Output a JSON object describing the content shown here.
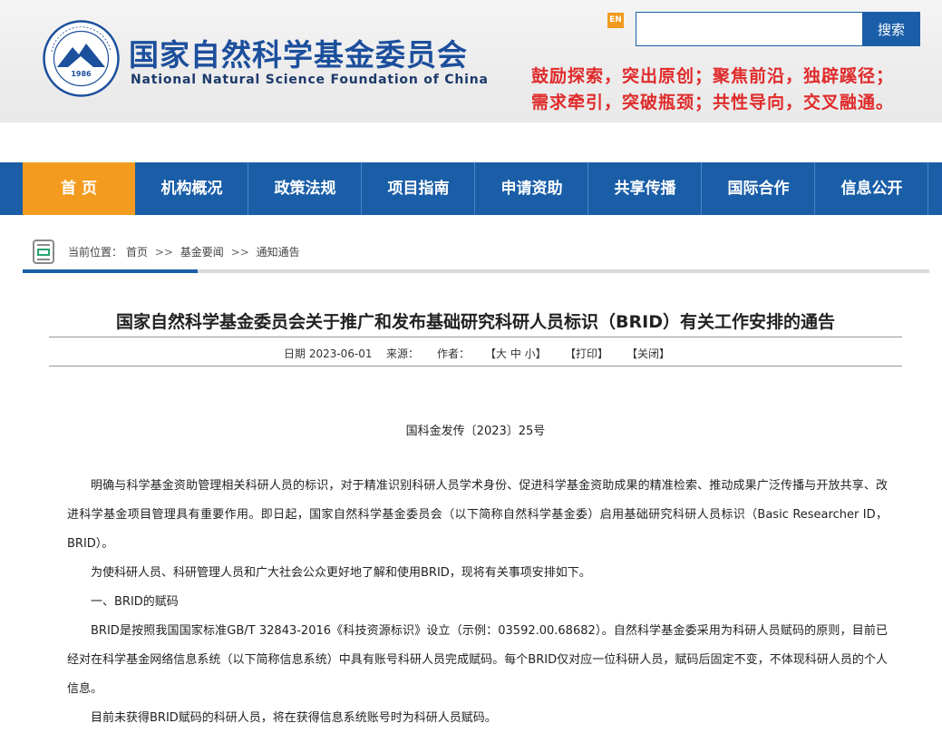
{
  "header": {
    "title_cn": "国家自然科学基金委员会",
    "title_en": "National Natural Science Foundation of China",
    "logo_year": "1986",
    "en_label": "EN",
    "search_placeholder": "",
    "search_label": "搜索",
    "slogan_line1": "鼓励探索，突出原创；聚焦前沿，独辟蹊径；",
    "slogan_line2": "需求牵引，突破瓶颈；共性导向，交叉融通。"
  },
  "nav": {
    "items": [
      "首  页",
      "机构概况",
      "政策法规",
      "项目指南",
      "申请资助",
      "共享传播",
      "国际合作",
      "信息公开"
    ]
  },
  "breadcrumb": {
    "prefix": "当前位置：",
    "items": [
      "首页",
      "基金要闻",
      "通知通告"
    ],
    "separator": ">>"
  },
  "article": {
    "title": "国家自然科学基金委员会关于推广和发布基础研究科研人员标识（BRID）有关工作安排的通告",
    "date": "日期 2023-06-01",
    "source": "来源：",
    "author": "作者：",
    "font_size": "【大 中 小】",
    "print": "【打印】",
    "close": "【关闭】",
    "doc_number": "国科金发传〔2023〕25号",
    "paragraphs": [
      "明确与科学基金资助管理相关科研人员的标识，对于精准识别科研人员学术身份、促进科学基金资助成果的精准检索、推动成果广泛传播与开放共享、改进科学基金项目管理具有重要作用。即日起，国家自然科学基金委员会（以下简称自然科学基金委）启用基础研究科研人员标识（Basic Researcher ID，BRID）。",
      "为使科研人员、科研管理人员和广大社会公众更好地了解和使用BRID，现将有关事项安排如下。",
      "一、BRID的赋码",
      "BRID是按照我国国家标准GB/T 32843-2016《科技资源标识》设立（示例：03592.00.68682）。自然科学基金委采用为科研人员赋码的原则，目前已经对在科学基金网络信息系统（以下简称信息系统）中具有账号科研人员完成赋码。每个BRID仅对应一位科研人员，赋码后固定不变，不体现科研人员的个人信息。",
      "目前未获得BRID赋码的科研人员，将在获得信息系统账号时为科研人员赋码。"
    ]
  },
  "colors": {
    "brand_blue": "#1a5ea8",
    "nav_active": "#f39b1f",
    "slogan_red": "#e02b2b"
  }
}
